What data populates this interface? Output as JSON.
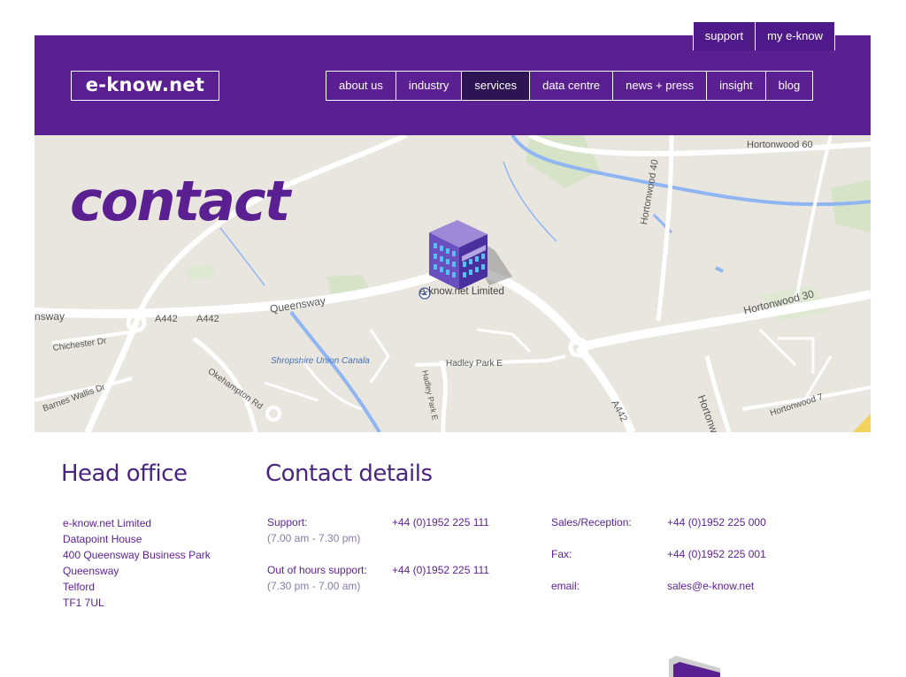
{
  "util_nav": {
    "support": "support",
    "my_eknow": "my e-know"
  },
  "header": {
    "logo": "e-know.net",
    "nav": [
      {
        "label": "about us"
      },
      {
        "label": "industry"
      },
      {
        "label": "services",
        "active": true
      },
      {
        "label": "data centre"
      },
      {
        "label": "news + press"
      },
      {
        "label": "insight"
      },
      {
        "label": "blog"
      }
    ]
  },
  "hero": {
    "title": "contact"
  },
  "map": {
    "pin_label": "e-know.net Limited",
    "labels": {
      "hortonwood60": "Hortonwood 60",
      "hortonwood40": "Hortonwood 40",
      "hortonwood30": "Hortonwood 30",
      "hortonwood7": "Hortonwood 7",
      "hortonw": "Hortonw",
      "queensway": "Queensway",
      "sway": "nsway",
      "a442a": "A442",
      "a442b": "A442",
      "a442c": "A442",
      "chichester": "Chichester Dr",
      "okehampton": "Okehampton Rd",
      "barnes": "Barnes Wallis Dr",
      "canal": "Shropshire Union Canala",
      "hadley": "Hadley Park E",
      "hadley_e": "Hadley Park E"
    },
    "colors": {
      "land": "#e9e6df",
      "road": "#ffffff",
      "water": "#8fb6f2",
      "park": "#c9dcb4"
    }
  },
  "head_office": {
    "heading": "Head office",
    "lines": [
      "e-know.net Limited",
      "Datapoint House",
      "400 Queensway Business Park",
      "Queensway",
      "Telford",
      "TF1 7UL"
    ]
  },
  "contact_details": {
    "heading": "Contact details",
    "support_label": "Support:",
    "support_hours": "(7.00 am - 7.30 pm)",
    "support_number": "+44 (0)1952 225 111",
    "ooh_label": "Out of hours support:",
    "ooh_hours": "(7.30 pm - 7.00 am)",
    "ooh_number": "+44 (0)1952 225 111",
    "sales_label": "Sales/Reception:",
    "sales_number": "+44 (0)1952 225 000",
    "fax_label": "Fax:",
    "fax_number": "+44 (0)1952 225 001",
    "email_label": "email:",
    "email_value": "sales@e-know.net"
  },
  "colors": {
    "brand_purple": "#5a1f91",
    "nav_active": "#2e1452"
  }
}
